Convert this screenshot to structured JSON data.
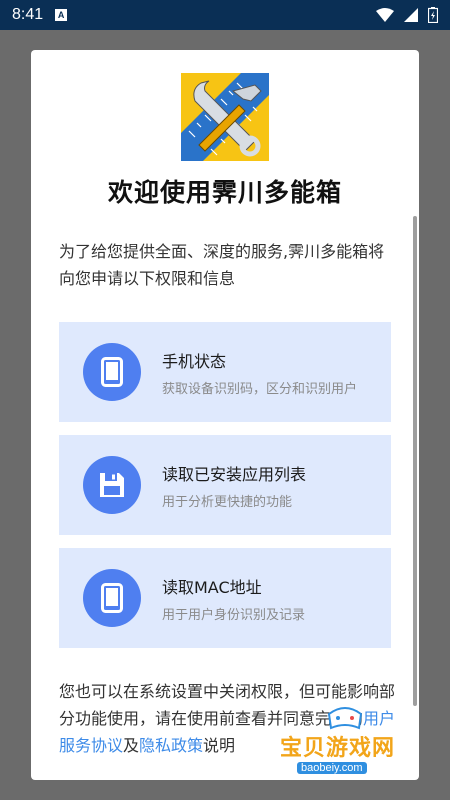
{
  "status_bar": {
    "time": "8:41",
    "notification_letter": "A"
  },
  "dialog": {
    "title": "欢迎使用霁川多能箱",
    "intro": "为了给您提供全面、深度的服务,霁川多能箱将向您申请以下权限和信息",
    "permissions": [
      {
        "title": "手机状态",
        "desc": "获取设备识别码，区分和识别用户",
        "icon": "phone-icon"
      },
      {
        "title": "读取已安装应用列表",
        "desc": "用于分析更快捷的功能",
        "icon": "floppy-disk-icon"
      },
      {
        "title": "读取MAC地址",
        "desc": "用于用户身份识别及记录",
        "icon": "phone-icon"
      }
    ],
    "footer": {
      "text_before": "您也可以在系统设置中关闭权限，但可能影响部分功能使用，请在使用前查看并同意完整的",
      "link_service": "用户服务协议",
      "text_and": "及",
      "link_privacy": "隐私政策",
      "text_after": "说明"
    }
  },
  "watermark": {
    "text": "宝贝游戏网",
    "url": "baobeiy.com"
  },
  "colors": {
    "status_bar_bg": "#0a2f55",
    "card_bg": "#dfe9fd",
    "icon_circle": "#4f7ff0",
    "link": "#3e8be8"
  }
}
